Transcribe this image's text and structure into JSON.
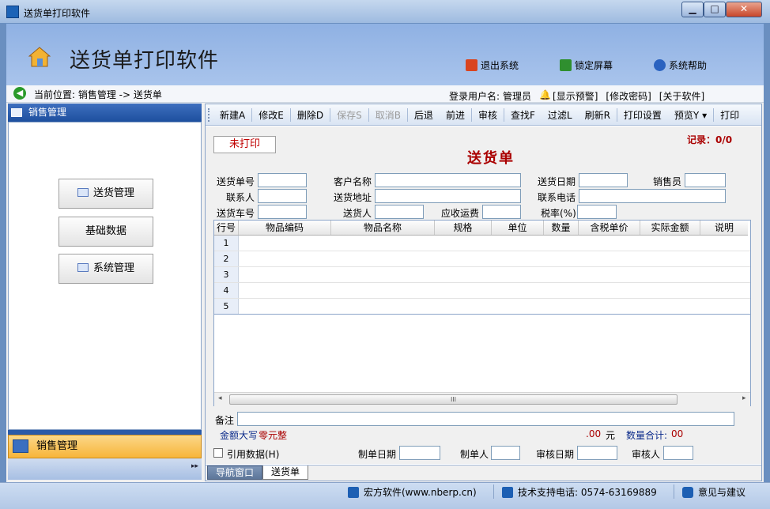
{
  "window": {
    "title": "送货单打印软件",
    "min_glyph": "▁",
    "max_glyph": "□",
    "close_glyph": "✕"
  },
  "header": {
    "app_title": "送货单打印软件",
    "links": [
      {
        "label": "退出系统",
        "icon": "exit-icon",
        "color": "#d9441f"
      },
      {
        "label": "锁定屏幕",
        "icon": "lock-screen-icon",
        "color": "#2f8f2f"
      },
      {
        "label": "系统帮助",
        "icon": "help-icon",
        "color": "#2a62c0"
      }
    ]
  },
  "location": {
    "back_glyph": "◀",
    "text": "当前位置: 销售管理 -> 送货单",
    "user_label": "登录用户名:",
    "user_name": "管理员",
    "alert_link": "[显示预警]",
    "change_pwd": "[修改密码]",
    "about": "[关于软件]"
  },
  "left_panel": {
    "title": "销售管理",
    "buttons": [
      "送货管理",
      "基础数据",
      "系统管理"
    ],
    "selected_section": "销售管理",
    "expand_glyph": "▸▸"
  },
  "toolbar": {
    "items": [
      {
        "label": "新建A",
        "enabled": true
      },
      {
        "label": "修改E",
        "enabled": true
      },
      {
        "label": "删除D",
        "enabled": true
      },
      {
        "label": "保存S",
        "enabled": false
      },
      {
        "label": "取消B",
        "enabled": false
      },
      {
        "label": "后退",
        "enabled": true
      },
      {
        "label": "前进",
        "enabled": true
      },
      {
        "label": "审核",
        "enabled": true
      },
      {
        "label": "查找F",
        "enabled": true
      },
      {
        "label": "过滤L",
        "enabled": true
      },
      {
        "label": "刷新R",
        "enabled": true
      },
      {
        "label": "打印设置",
        "enabled": true
      },
      {
        "label": "预览Y ▾",
        "enabled": true
      },
      {
        "label": "打印",
        "enabled": true
      }
    ]
  },
  "form": {
    "status": "未打印",
    "doc_title": "送货单",
    "records": "记录：0/0",
    "labels": {
      "order_no": "送货单号",
      "customer": "客户名称",
      "date": "送货日期",
      "salesman": "销售员",
      "contact": "联系人",
      "address": "送货地址",
      "phone": "联系电话",
      "vehicle": "送货车号",
      "deliverer": "送货人",
      "freight": "应收运费",
      "tax_rate": "税率(%)"
    },
    "values": {
      "order_no": "",
      "customer": "",
      "date": "",
      "salesman": "",
      "contact": "",
      "address": "",
      "phone": "",
      "vehicle": "",
      "deliverer": "",
      "freight": "",
      "tax_rate": ""
    }
  },
  "grid": {
    "columns": [
      "行号",
      "物品编码",
      "物品名称",
      "规格",
      "单位",
      "数量",
      "含税单价",
      "实际金额",
      "说明"
    ],
    "rows": [
      "1",
      "2",
      "3",
      "4",
      "5"
    ],
    "scroll_left": "◂",
    "scroll_right": "▸",
    "thumb_grip": "III"
  },
  "footer": {
    "note_label": "备注",
    "note_value": "",
    "amount_label": "金额大写",
    "amount_upper": "零元整",
    "amount_value": ".00",
    "unit": "元",
    "qty_label": "数量合计:",
    "qty_value": "00",
    "ref_label": "引用数据(H)",
    "make_date": "制单日期",
    "maker": "制单人",
    "audit_date": "审核日期",
    "auditor": "审核人"
  },
  "tabs": {
    "nav": "导航窗口",
    "current": "送货单"
  },
  "statusbar": {
    "company": "宏方软件(www.nberp.cn)",
    "support": "技术支持电话: 0574-63169889",
    "feedback": "意见与建议"
  }
}
